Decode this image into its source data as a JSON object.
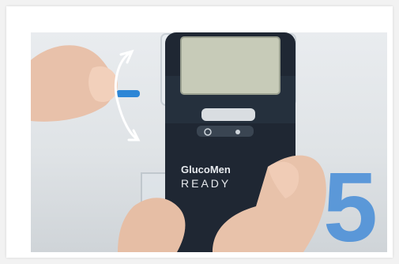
{
  "image": {
    "step_number": "5",
    "device": {
      "brand_line1": "GlucoMen",
      "brand_line2": "READY"
    },
    "icons": {
      "rotation_arrow": "rotate-arrow-icon",
      "power_button": "power-button-icon"
    },
    "colors": {
      "step_number": "#4a8fd8",
      "device_body": "#1f2733",
      "screen": "#c7cbb8",
      "lancet_cap": "#2d86d6"
    }
  }
}
